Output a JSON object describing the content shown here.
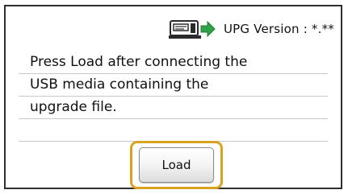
{
  "header": {
    "icon": "sewing-machine-usb-icon",
    "version_label": "UPG Version : *.**"
  },
  "message": {
    "lines": [
      "Press Load after connecting the",
      "USB media containing the",
      "upgrade file.",
      ""
    ]
  },
  "actions": {
    "load_label": "Load"
  },
  "colors": {
    "frame_border": "#2f2f2f",
    "focus_ring": "#d9a21f",
    "icon_green": "#2fa14a",
    "icon_dark": "#2a2a2a"
  }
}
